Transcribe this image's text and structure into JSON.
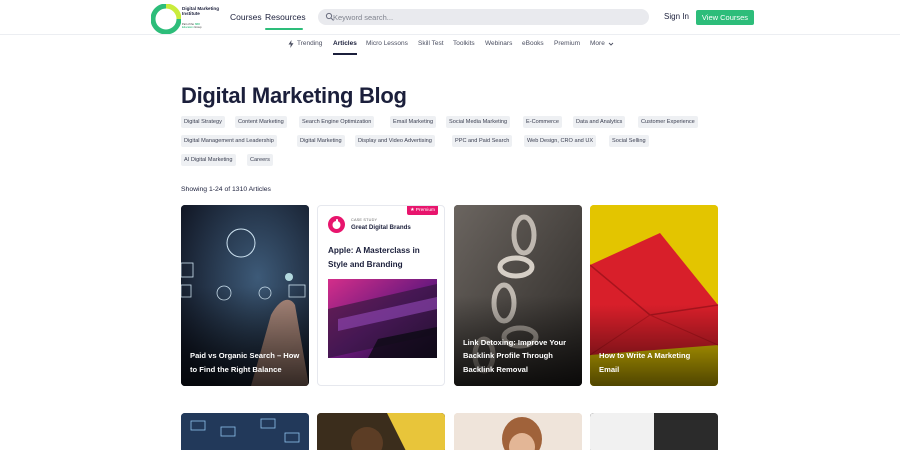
{
  "brand": {
    "name": "Digital Marketing Institute",
    "tagline_prefix": "Part of the",
    "tagline_highlight": "SBR Education",
    "tagline_suffix": "Group"
  },
  "header": {
    "nav": [
      "Courses",
      "Resources"
    ],
    "active_nav": "Resources",
    "search_placeholder": "Keyword search...",
    "signin_label": "Sign In",
    "cta_label": "View Courses"
  },
  "tabs": [
    "Trending",
    "Articles",
    "Micro Lessons",
    "Skill Test",
    "Toolkits",
    "Webinars",
    "eBooks",
    "Premium",
    "More"
  ],
  "active_tab": "Articles",
  "page_title": "Digital Marketing Blog",
  "tags": [
    "Digital Strategy",
    "Content Marketing",
    "Search Engine Optimization",
    "Email Marketing",
    "Social Media Marketing",
    "E-Commerce",
    "Data and Analytics",
    "Customer Experience",
    "Digital Management and Leadership",
    "Digital Marketing",
    "Display and Video Advertising",
    "PPC and Paid Search",
    "Web Design, CRO and UX",
    "Social Selling",
    "AI Digital Marketing",
    "Careers"
  ],
  "showing_text": "Showing 1-24 of 1310 Articles",
  "cards": [
    {
      "title": "Paid vs Organic Search – How to Find the Right Balance"
    },
    {
      "badge": "★ Premium",
      "kicker": "CASE STUDY",
      "brand": "Great Digital Brands",
      "title": "Apple: A Masterclass in Style and Branding"
    },
    {
      "title": "Link Detoxing: Improve Your Backlink Profile Through Backlink Removal"
    },
    {
      "title": "How to Write A Marketing Email"
    }
  ],
  "colors": {
    "accent_green": "#2dbd7a",
    "premium_pink": "#e8156d",
    "navy": "#1b1f3b"
  }
}
